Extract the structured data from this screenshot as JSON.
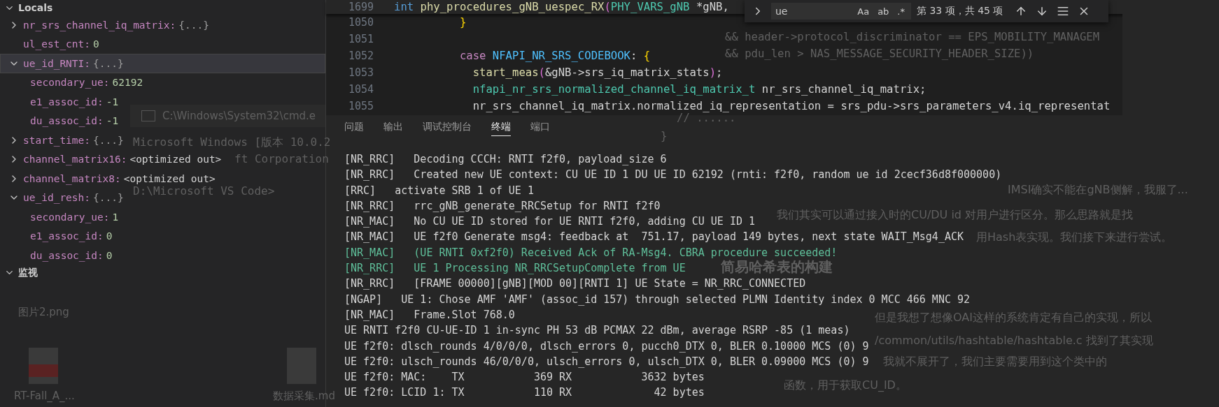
{
  "debug_panel": {
    "sections": [
      {
        "title": "Locals",
        "expanded": true
      },
      {
        "title": "监视",
        "expanded": true
      }
    ],
    "variables": [
      {
        "kind": "node",
        "name": "nr_srs_channel_iq_matrix:",
        "value": "{...}",
        "expanded": false,
        "selected": false
      },
      {
        "kind": "leaf",
        "name": "ul_est_cnt:",
        "value": "0",
        "selected": false
      },
      {
        "kind": "node",
        "name": "ue_id_RNTI:",
        "value": "{...}",
        "expanded": true,
        "selected": true,
        "children": [
          {
            "kind": "leaf",
            "name": "secondary_ue:",
            "value": "62192",
            "selected": false
          },
          {
            "kind": "leaf",
            "name": "e1_assoc_id:",
            "value": "-1",
            "selected": false
          },
          {
            "kind": "leaf",
            "name": "du_assoc_id:",
            "value": "-1",
            "selected": false
          }
        ]
      },
      {
        "kind": "node",
        "name": "start_time:",
        "value": "{...}",
        "expanded": false,
        "selected": false
      },
      {
        "kind": "node",
        "name": "channel_matrix16:",
        "value": "<optimized out>",
        "expanded": false,
        "selected": false
      },
      {
        "kind": "node",
        "name": "channel_matrix8:",
        "value": "<optimized out>",
        "expanded": false,
        "selected": false
      },
      {
        "kind": "node",
        "name": "ue_id_resh:",
        "value": "{...}",
        "expanded": true,
        "selected": false,
        "children": [
          {
            "kind": "leaf",
            "name": "secondary_ue:",
            "value": "1",
            "selected": false
          },
          {
            "kind": "leaf",
            "name": "e1_assoc_id:",
            "value": "0",
            "selected": false
          },
          {
            "kind": "leaf",
            "name": "du_assoc_id:",
            "value": "0",
            "selected": false
          }
        ]
      }
    ]
  },
  "editor": {
    "lines": [
      {
        "number": "1699",
        "sticky": true,
        "tokens": [
          {
            "kind": "keyword",
            "text": "int"
          },
          {
            "kind": "function",
            "text": " phy_procedures_gNB_uespec_RX"
          },
          {
            "kind": "punct",
            "text": "("
          },
          {
            "kind": "type",
            "text": "PHY_VARS_gNB"
          },
          {
            "kind": "plain",
            "text": " *gNB,"
          }
        ]
      },
      {
        "number": "1050",
        "sticky": false,
        "tokens": [
          {
            "kind": "brace",
            "text": "          }"
          }
        ]
      },
      {
        "number": "1051",
        "sticky": false
      },
      {
        "number": "1052",
        "sticky": false,
        "tokens": [
          {
            "kind": "control",
            "text": "          case"
          },
          {
            "kind": "constant",
            "text": " NFAPI_NR_SRS_CODEBOOK"
          },
          {
            "kind": "plain",
            "text": ": "
          },
          {
            "kind": "brace",
            "text": "{"
          }
        ]
      },
      {
        "number": "1053",
        "sticky": false,
        "tokens": [
          {
            "kind": "function",
            "text": "            start_meas"
          },
          {
            "kind": "punct",
            "text": "("
          },
          {
            "kind": "plain",
            "text": "&gNB->srs_iq_matrix_stats"
          },
          {
            "kind": "punct",
            "text": ")"
          },
          {
            "kind": "plain",
            "text": ";"
          }
        ]
      },
      {
        "number": "1054",
        "sticky": false,
        "tokens": [
          {
            "kind": "type",
            "text": "            nfapi_nr_srs_normalized_channel_iq_matrix_t"
          },
          {
            "kind": "plain",
            "text": " nr_srs_channel_iq_matrix;"
          }
        ]
      },
      {
        "number": "1055",
        "sticky": false,
        "tokens": [
          {
            "kind": "plain",
            "text": "            nr_srs_channel_iq_matrix.normalized_iq_representation = srs_pdu->srs_parameters_v4.iq_representat"
          }
        ]
      }
    ],
    "find_widget": {
      "query": "ue",
      "options": [
        {
          "label": "Aa",
          "on": false
        },
        {
          "label": "ab",
          "on": false
        },
        {
          "label": ".*",
          "on": false
        }
      ],
      "result": "第 33 项，共 45 项"
    }
  },
  "terminal": {
    "tabs": [
      {
        "label": "问题",
        "selected": false
      },
      {
        "label": "输出",
        "selected": false
      },
      {
        "label": "调试控制台",
        "selected": false
      },
      {
        "label": "终端",
        "selected": true
      },
      {
        "label": "端口",
        "selected": false
      }
    ],
    "lines": [
      {
        "kind": "normal",
        "text": "[NR_RRC]   Decoding CCCH: RNTI f2f0, payload_size 6"
      },
      {
        "kind": "normal",
        "text": "[NR_RRC]   Created new UE context: CU UE ID 1 DU UE ID 62192 (rnti: f2f0, random ue id 2cecf36d8f000000)"
      },
      {
        "kind": "normal",
        "text": "[RRC]   activate SRB 1 of UE 1"
      },
      {
        "kind": "normal",
        "text": "[NR_RRC]   rrc_gNB_generate_RRCSetup for RNTI f2f0"
      },
      {
        "kind": "normal",
        "text": "[NR_MAC]   No CU UE ID stored for UE RNTI f2f0, adding CU UE ID 1"
      },
      {
        "kind": "normal",
        "text": "[NR_MAC]   UE f2f0 Generate msg4: feedback at  751.17, payload 149 bytes, next state WAIT_Msg4_ACK"
      },
      {
        "kind": "success",
        "text": "[NR_MAC]   (UE RNTI 0xf2f0) Received Ack of RA-Msg4. CBRA procedure succeeded!"
      },
      {
        "kind": "success",
        "text": "[NR_RRC]   UE 1 Processing NR_RRCSetupComplete from UE"
      },
      {
        "kind": "normal",
        "text": "[NR_RRC]   [FRAME 00000][gNB][MOD 00][RNTI 1] UE State = NR_RRC_CONNECTED"
      },
      {
        "kind": "normal",
        "text": "[NGAP]   UE 1: Chose AMF 'AMF' (assoc_id 157) through selected PLMN Identity index 0 MCC 466 MNC 92"
      },
      {
        "kind": "normal",
        "text": "[NR_MAC]   Frame.Slot 768.0"
      },
      {
        "kind": "normal",
        "text": "UE RNTI f2f0 CU-UE-ID 1 in-sync PH 53 dB PCMAX 22 dBm, average RSRP -85 (1 meas)"
      },
      {
        "kind": "normal",
        "text": "UE f2f0: dlsch_rounds 4/0/0/0, dlsch_errors 0, pucch0_DTX 0, BLER 0.10000 MCS (0) 9"
      },
      {
        "kind": "normal",
        "text": "UE f2f0: ulsch_rounds 46/0/0/0, ulsch_errors 0, ulsch_DTX 0, BLER 0.09000 MCS (0) 9"
      },
      {
        "kind": "normal",
        "text": "UE f2f0: MAC:    TX           369 RX           3632 bytes"
      },
      {
        "kind": "normal",
        "text": "UE f2f0: LCID 1: TX           110 RX             42 bytes"
      }
    ]
  },
  "background_windows": {
    "cmd_window": {
      "title": "C:\\Windows\\System32\\cmd.e",
      "lines": [
        "Microsoft Windows [版本 10.0.2",
        "ft Corporation",
        "D:\\Microsoft VS Code>"
      ]
    },
    "desktop_files": [
      {
        "kind": "image",
        "label": "图片2.png"
      },
      {
        "kind": "pdf",
        "label": "RT-Fall_A_..."
      },
      {
        "kind": "doc",
        "label": "数据采集.md"
      }
    ],
    "code_fragments": [
      "&& header->protocol_discriminator == EPS_MOBILITY_MANAGEM",
      "&& pdu_len > NAS_MESSAGE_SECURITY_HEADER_SIZE))",
      "// ......",
      "}"
    ],
    "article_lines": [
      "IMSI确实不能在gNB侧解，我服了...",
      "我们其实可以通过接入时的CU/DU id 对用户进行区分。那么思路就是找",
      "用Hash表实现。我们接下来进行尝试。",
      "简易哈希表的构建",
      "但是我想了想像OAI这样的系统肯定有自己的实现，所以",
      "/common/utils/hashtable/hashtable.c 找到了其实现",
      "我就不展开了，我们主要需要用到这个类中的",
      "函数，用于获取CU_ID。"
    ]
  }
}
